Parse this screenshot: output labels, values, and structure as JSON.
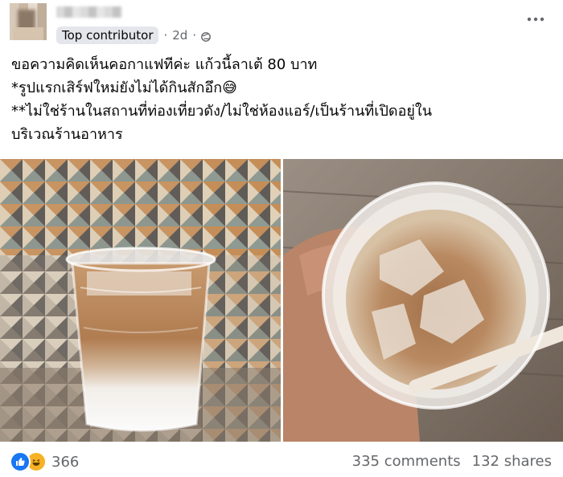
{
  "post": {
    "badge": "Top contributor",
    "dot1": "·",
    "time": "2d",
    "dot2": "·",
    "text_lines": [
      "ขอความคิดเห็นคอกาแฟทีค่ะ แก้วนี้ลาเต้ 80 บาท",
      "*รูปแรกเสิร์ฟใหม่ยังไม่ได้กินสักอึก😅",
      "**ไม่ใช่ร้านในสถานที่ท่องเที่ยวดัง/ไม่ใช่ห้องแอร์/เป็นร้านที่เปิดอยู่ใน",
      "บริเวณร้านอาหาร"
    ]
  },
  "footer": {
    "reaction_count": "366",
    "comments": "335 comments",
    "shares": "132 shares"
  },
  "icons": {
    "more": "more-horizontal-icon",
    "audience": "globe-icon",
    "like": "like-reaction-icon",
    "haha": "haha-reaction-icon"
  },
  "colors": {
    "secondary_text": "#65676b",
    "badge_bg": "#e4e6eb",
    "like_blue": "#1877f2",
    "haha_yellow": "#f7b125"
  }
}
